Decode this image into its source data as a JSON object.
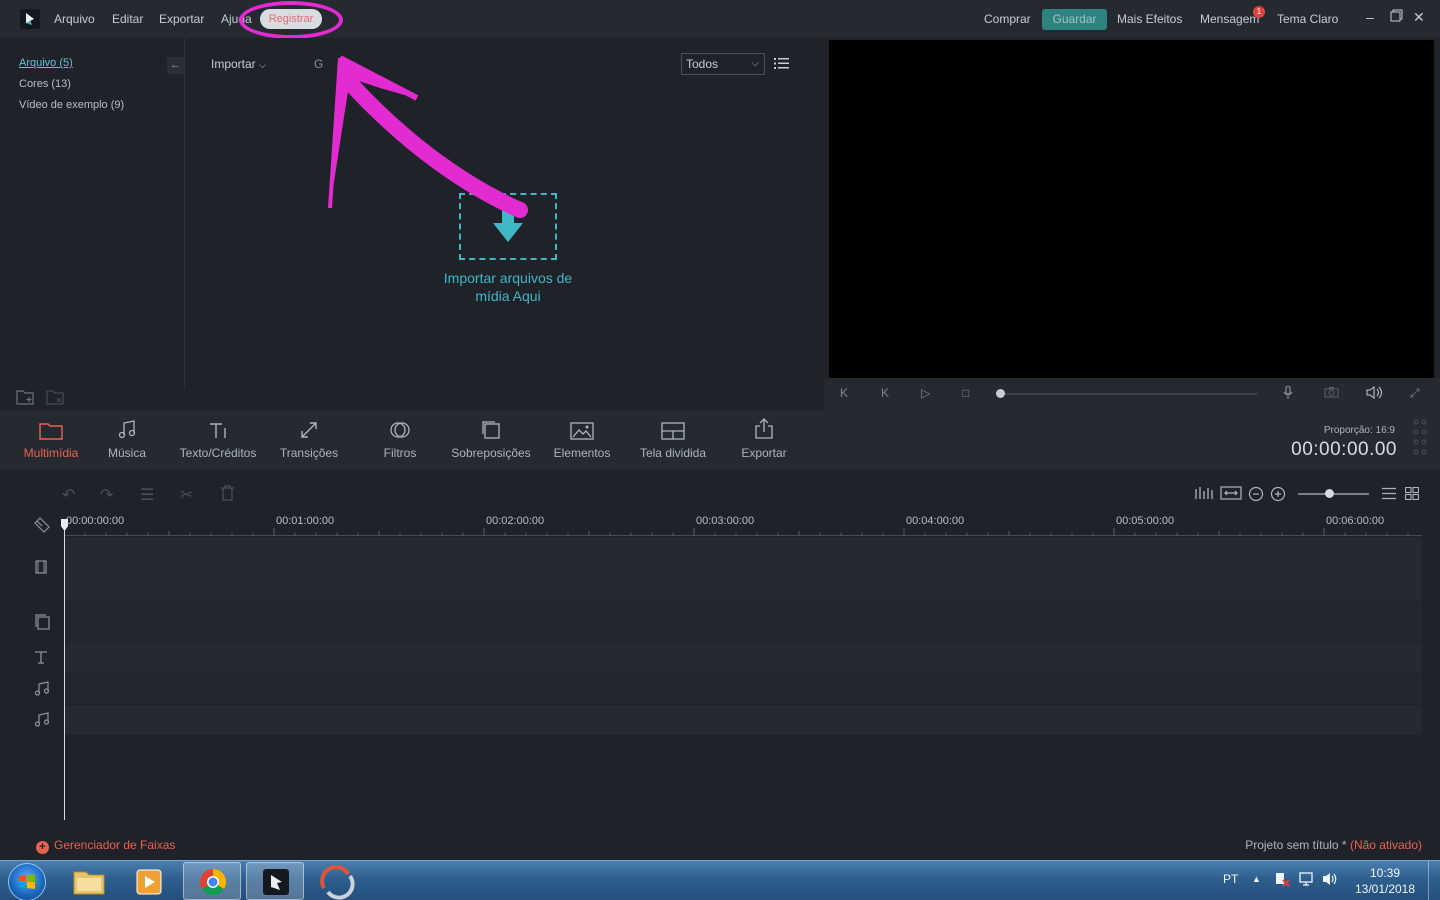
{
  "menu": {
    "items": [
      "Arquivo",
      "Editar",
      "Exportar",
      "Ajuda"
    ],
    "register": "Registrar",
    "buy": "Comprar",
    "save": "Guardar",
    "more_effects": "Mais Efeitos",
    "messages": "Mensagem",
    "messages_badge": "1",
    "theme": "Tema Claro"
  },
  "library": {
    "items": [
      "Arquivo (5)",
      "Cores (13)",
      "Vídeo de exemplo (9)"
    ]
  },
  "media": {
    "import_label": "Importar",
    "cut_letter": "G",
    "filter_value": "Todos",
    "drop_line1": "Importar arquivos de",
    "drop_line2": "mídia Aqui"
  },
  "toolbar": {
    "tabs": [
      "Multimídia",
      "Música",
      "Texto/Créditos",
      "Transições",
      "Filtros",
      "Sobreposições",
      "Elementos",
      "Tela dividida",
      "Exportar"
    ],
    "ratio": "Proporção: 16:9",
    "timecode": "00:00:00.00"
  },
  "timeline": {
    "ruler": [
      "00:00:00:00",
      "00:01:00:00",
      "00:02:00:00",
      "00:03:00:00",
      "00:04:00:00",
      "00:05:00:00",
      "00:06:00:00"
    ],
    "track_manager": "Gerenciador de Faixas",
    "project_name": "Projeto sem título *",
    "not_activated": "(Não ativado)"
  },
  "taskbar": {
    "lang": "PT",
    "time": "10:39",
    "date": "13/01/2018"
  },
  "colors": {
    "accent_teal": "#3fb8c6",
    "accent_red": "#e8614f",
    "annotation_magenta": "#e22bd0"
  }
}
